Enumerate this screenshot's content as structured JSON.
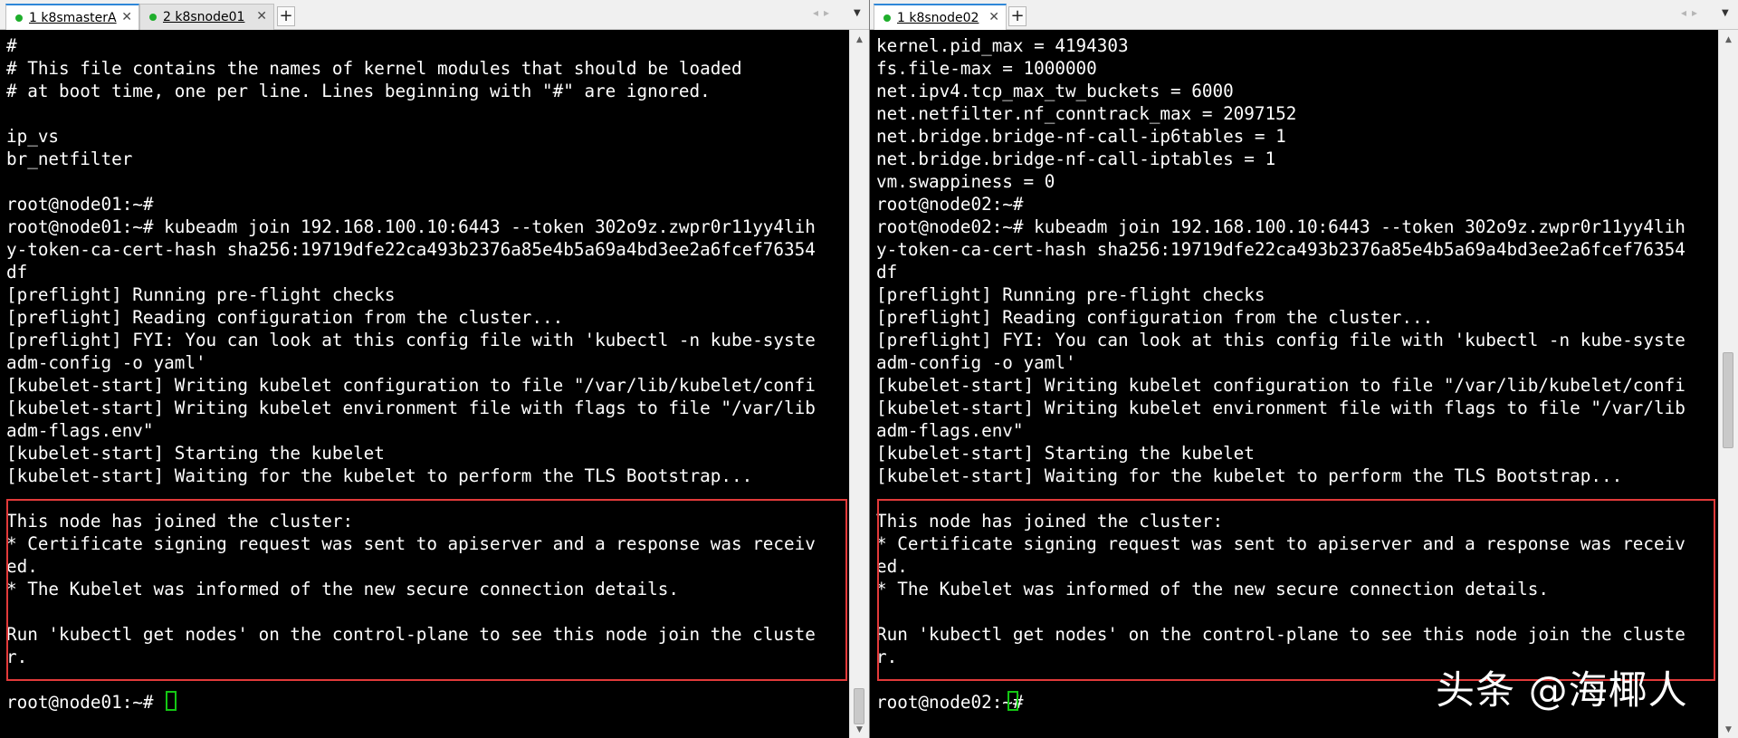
{
  "colors": {
    "terminal_bg": "#000000",
    "terminal_fg": "#ffffff",
    "highlight_border": "#e23a3a",
    "cursor": "#14c814",
    "tab_active_accent": "#2f87d8",
    "status_connected": "#1fae2c"
  },
  "left_pane": {
    "tabs": [
      {
        "label": "1 k8smasterA",
        "status": "connected",
        "active": true
      },
      {
        "label": "2 k8snode01",
        "status": "connected",
        "active": false
      }
    ],
    "add_tab_label": "+",
    "lines": [
      "#",
      "# This file contains the names of kernel modules that should be loaded",
      "# at boot time, one per line. Lines beginning with \"#\" are ignored.",
      "",
      "ip_vs",
      "br_netfilter",
      "",
      "root@node01:~#",
      "root@node01:~# kubeadm join 192.168.100.10:6443 --token 302o9z.zwpr0r11yy4lih",
      "y-token-ca-cert-hash sha256:19719dfe22ca493b2376a85e4b5a69a4bd3ee2a6fcef76354",
      "df",
      "[preflight] Running pre-flight checks",
      "[preflight] Reading configuration from the cluster...",
      "[preflight] FYI: You can look at this config file with 'kubectl -n kube-syste",
      "adm-config -o yaml'",
      "[kubelet-start] Writing kubelet configuration to file \"/var/lib/kubelet/confi",
      "[kubelet-start] Writing kubelet environment file with flags to file \"/var/lib",
      "adm-flags.env\"",
      "[kubelet-start] Starting the kubelet",
      "[kubelet-start] Waiting for the kubelet to perform the TLS Bootstrap...",
      "",
      "This node has joined the cluster:",
      "* Certificate signing request was sent to apiserver and a response was receiv",
      "ed.",
      "* The Kubelet was informed of the new secure connection details.",
      "",
      "Run 'kubectl get nodes' on the control-plane to see this node join the cluste",
      "r.",
      "",
      "root@node01:~# "
    ]
  },
  "right_pane": {
    "tabs": [
      {
        "label": "1 k8snode02",
        "status": "connected",
        "active": true
      }
    ],
    "add_tab_label": "+",
    "lines": [
      "kernel.pid_max = 4194303",
      "fs.file-max = 1000000",
      "net.ipv4.tcp_max_tw_buckets = 6000",
      "net.netfilter.nf_conntrack_max = 2097152",
      "net.bridge.bridge-nf-call-ip6tables = 1",
      "net.bridge.bridge-nf-call-iptables = 1",
      "vm.swappiness = 0",
      "root@node02:~#",
      "root@node02:~# kubeadm join 192.168.100.10:6443 --token 302o9z.zwpr0r11yy4lih",
      "y-token-ca-cert-hash sha256:19719dfe22ca493b2376a85e4b5a69a4bd3ee2a6fcef76354",
      "df",
      "[preflight] Running pre-flight checks",
      "[preflight] Reading configuration from the cluster...",
      "[preflight] FYI: You can look at this config file with 'kubectl -n kube-syste",
      "adm-config -o yaml'",
      "[kubelet-start] Writing kubelet configuration to file \"/var/lib/kubelet/confi",
      "[kubelet-start] Writing kubelet environment file with flags to file \"/var/lib",
      "adm-flags.env\"",
      "[kubelet-start] Starting the kubelet",
      "[kubelet-start] Waiting for the kubelet to perform the TLS Bootstrap...",
      "",
      "This node has joined the cluster:",
      "* Certificate signing request was sent to apiserver and a response was receiv",
      "ed.",
      "* The Kubelet was informed of the new secure connection details.",
      "",
      "Run 'kubectl get nodes' on the control-plane to see this node join the cluste",
      "r.",
      "",
      "root@node02:~# "
    ]
  },
  "watermark": "头条 @海椰人"
}
